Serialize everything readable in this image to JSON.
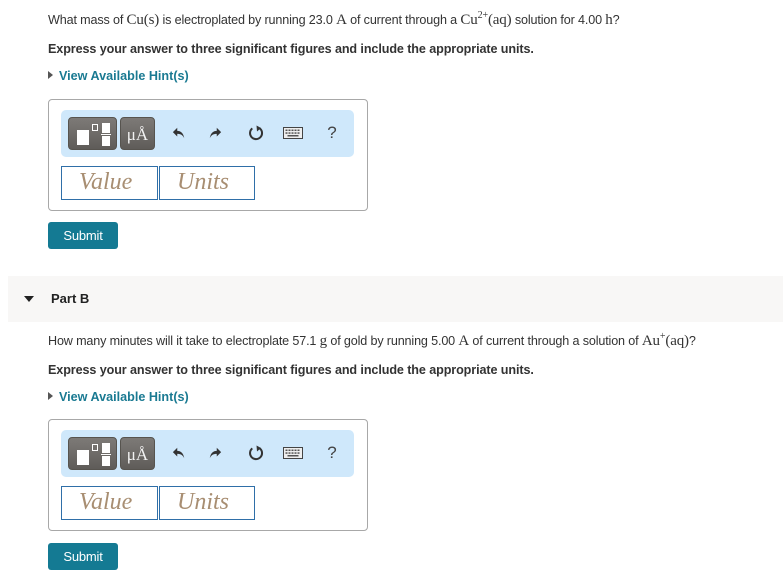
{
  "partA": {
    "question": {
      "t1": "What mass of ",
      "m1": "Cu(s)",
      "t2": " is electroplated by running 23.0 ",
      "m2": "A",
      "t3": " of current through a ",
      "m3": "Cu",
      "m3_sup": "2+",
      "m3b": "(aq)",
      "t4": " solution for 4.00 ",
      "m4": "h",
      "t5": "?"
    },
    "instruction": "Express your answer to three significant figures and include the appropriate units.",
    "hint_link": "View Available Hint(s)",
    "value_placeholder": "Value",
    "units_placeholder": "Units",
    "submit_label": "Submit"
  },
  "partB": {
    "header": "Part B",
    "question": {
      "t1": "How many minutes will it take to electroplate 57.1 ",
      "m1": "g",
      "t2": " of gold by running 5.00 ",
      "m2": "A",
      "t3": " of current through a solution of ",
      "m3": "Au",
      "m3_sup": "+",
      "m3b": "(aq)",
      "t4": "?"
    },
    "instruction": "Express your answer to three significant figures and include the appropriate units.",
    "hint_link": "View Available Hint(s)",
    "value_placeholder": "Value",
    "units_placeholder": "Units",
    "submit_label": "Submit"
  },
  "toolbar": {
    "units_button_label": "μÅ",
    "icons": [
      "templates-icon",
      "units-icon",
      "undo-icon",
      "redo-icon",
      "reset-icon",
      "keyboard-icon",
      "help-icon"
    ],
    "help_label": "?"
  },
  "colors": {
    "accent": "#147a93",
    "hint_link": "#1a7a92",
    "toolbar_bg": "#cfe8fb",
    "field_border": "#2f6fa8",
    "placeholder": "#a88e72",
    "part_band": "#f8f7f6"
  }
}
